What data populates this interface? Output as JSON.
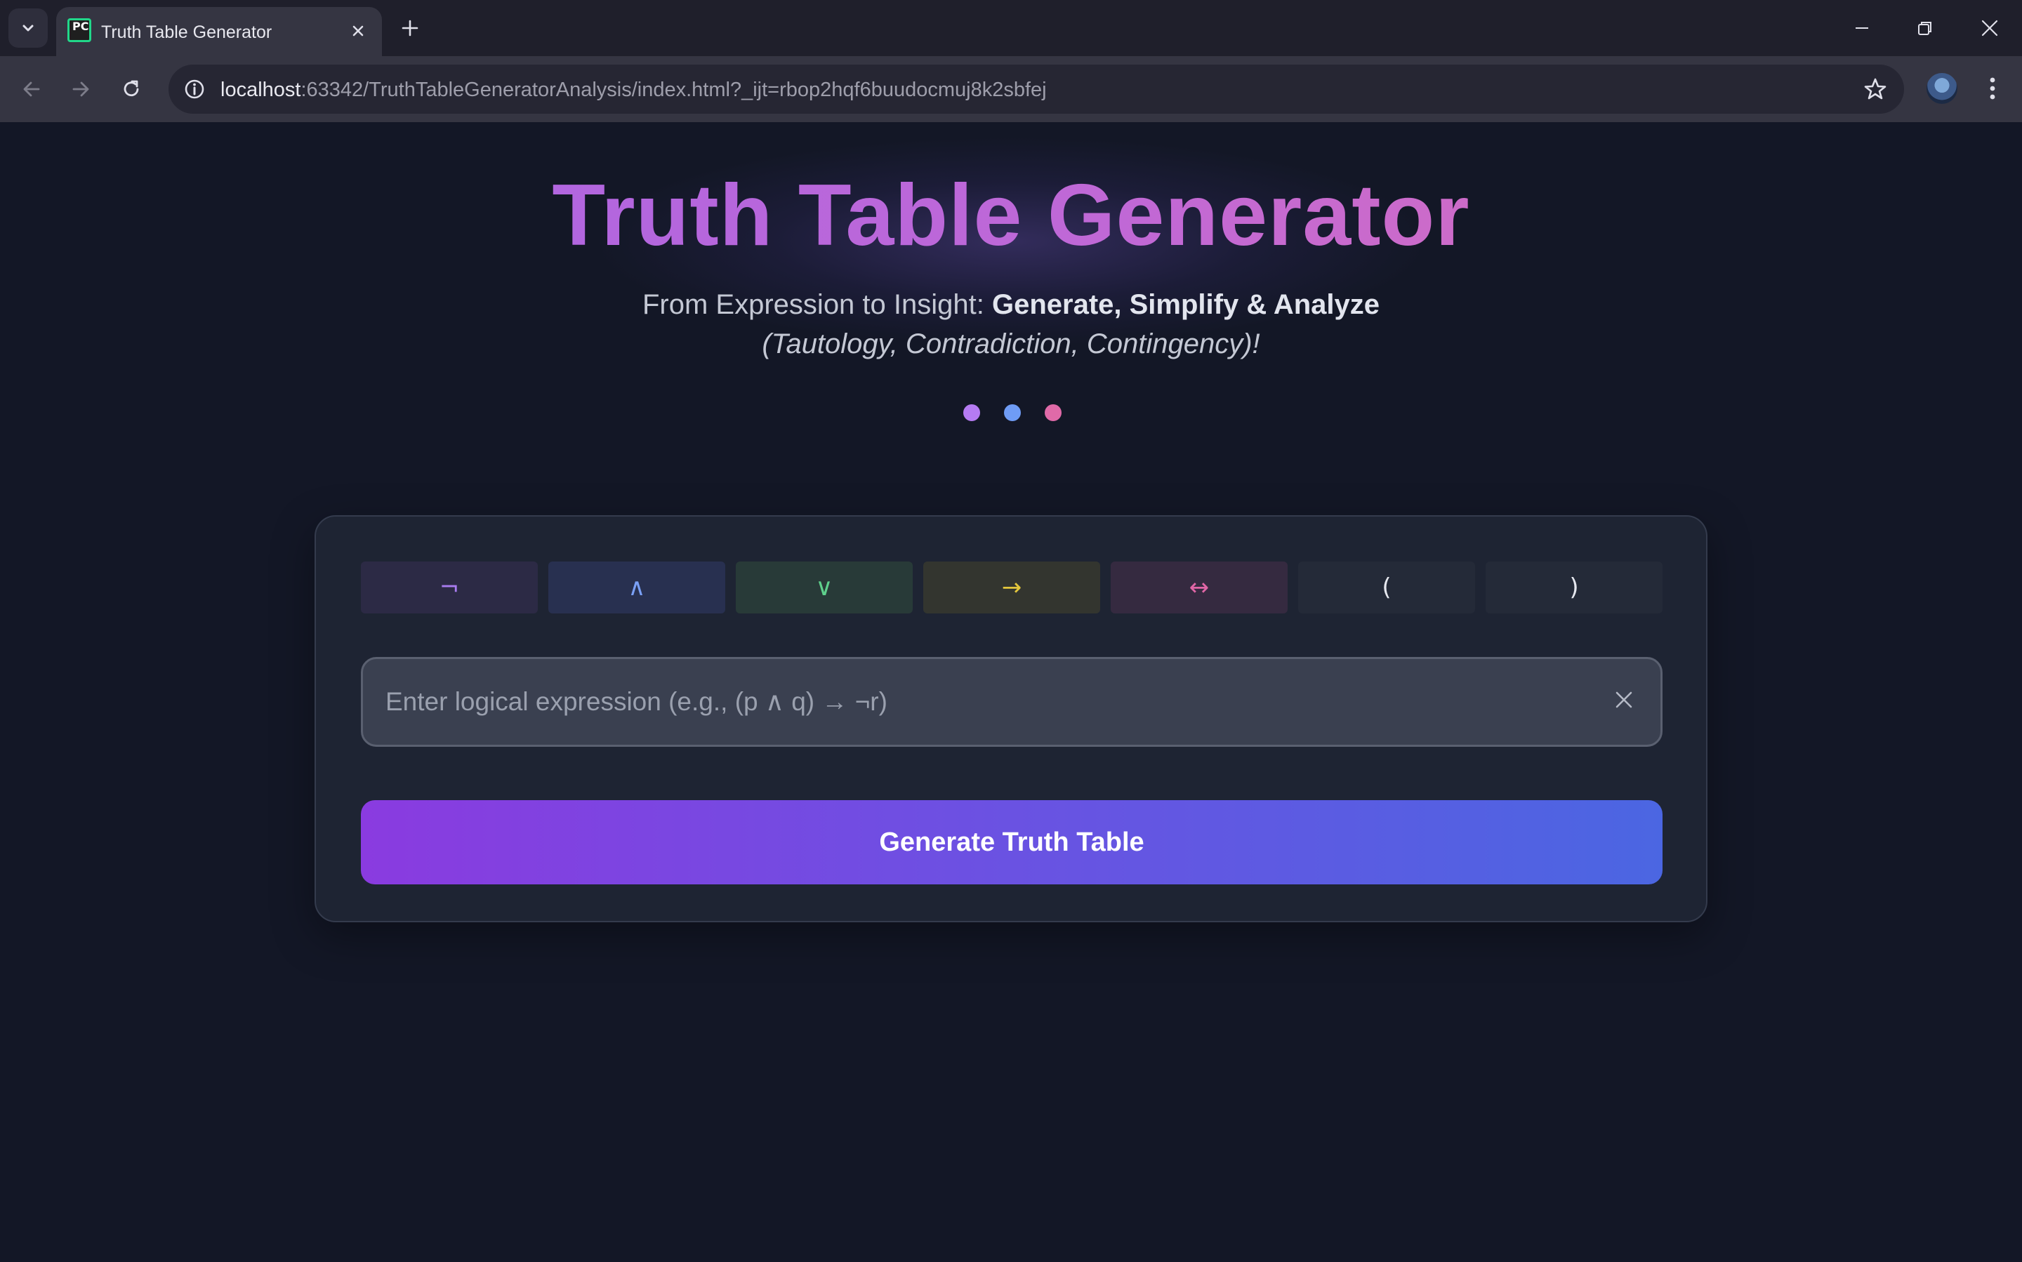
{
  "browser": {
    "tab_title": "Truth Table Generator",
    "favicon_text": "PC",
    "url_host": "localhost",
    "url_rest": ":63342/TruthTableGeneratorAnalysis/index.html?_ijt=rbop2hqf6buudocmuj8k2sbfej",
    "icons": [
      "tab-search-icon",
      "close-icon",
      "plus-icon",
      "minimize-icon",
      "restore-icon",
      "close-window-icon",
      "back-arrow-icon",
      "forward-arrow-icon",
      "reload-icon",
      "site-info-icon",
      "star-icon",
      "profile-avatar",
      "more-vert-icon"
    ]
  },
  "hero": {
    "title": "Truth Table Generator",
    "subtitle_prefix": "From Expression to Insight: ",
    "subtitle_bold": "Generate, Simplify & Analyze",
    "subtitle_italic": "(Tautology, Contradiction, Contingency)!",
    "dot_colors": [
      "#b57bf2",
      "#6f9cf5",
      "#e06aa8"
    ]
  },
  "operators": [
    {
      "symbol": "¬",
      "color": "#a97cf0",
      "bg": "#2c2a45"
    },
    {
      "symbol": "∧",
      "color": "#7aa0f6",
      "bg": "#283050"
    },
    {
      "symbol": "∨",
      "color": "#5fd08c",
      "bg": "#283a38"
    },
    {
      "symbol": "→",
      "color": "#e3c63c",
      "bg": "#33352f"
    },
    {
      "symbol": "↔",
      "color": "#e066a6",
      "bg": "#352a40"
    },
    {
      "symbol": "(",
      "color": "#e6e8ef",
      "bg": "#242a38"
    },
    {
      "symbol": ")",
      "color": "#e6e8ef",
      "bg": "#242a38"
    }
  ],
  "input": {
    "placeholder": "Enter logical expression (e.g., (p ∧ q) → ¬r)",
    "value": ""
  },
  "generate_button": {
    "label": "Generate Truth Table"
  }
}
